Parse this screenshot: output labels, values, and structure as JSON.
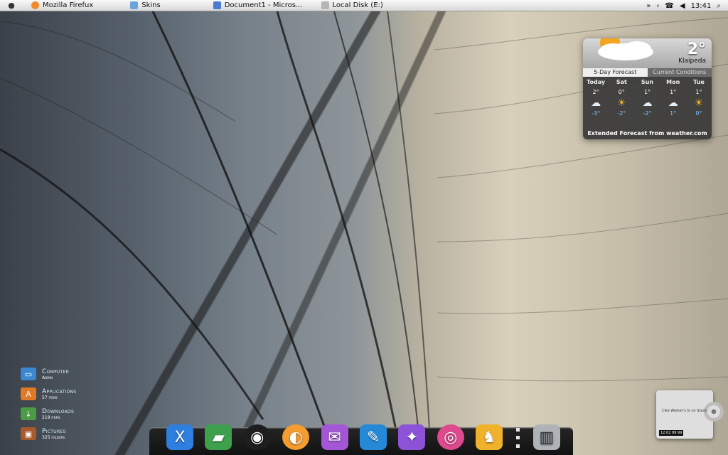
{
  "menubar": {
    "apple_icon": "apple-icon",
    "items": [
      {
        "label": "Mozilla Firefux",
        "icon": "firefox-icon",
        "color": "#f08a2a"
      },
      {
        "label": "Skins",
        "icon": "folder-icon",
        "color": "#6ca3dd"
      },
      {
        "label": "Document1 - Micros...",
        "icon": "document-icon",
        "color": "#4b7bd2"
      },
      {
        "label": "Local Disk (E:)",
        "icon": "drive-icon",
        "color": "#b5b5b5"
      }
    ],
    "right": {
      "overflow": "»",
      "tray_icons": [
        "back-icon",
        "phone-icon",
        "speaker-icon"
      ],
      "time": "13:41",
      "search_icon": "magnifier-icon"
    }
  },
  "weather": {
    "temperature": "2°",
    "city": "Klaipeda",
    "tabs": [
      "5-Day Forecast",
      "Current Conditions"
    ],
    "active_tab": 0,
    "days": [
      {
        "name": "Today",
        "high": "2°",
        "low": "-3°",
        "icon": "snow-cloud-icon"
      },
      {
        "name": "Sat",
        "high": "0°",
        "low": "-2°",
        "icon": "sun-cloud-icon"
      },
      {
        "name": "Sun",
        "high": "1°",
        "low": "-2°",
        "icon": "snow-cloud-icon"
      },
      {
        "name": "Mon",
        "high": "1°",
        "low": "1°",
        "icon": "snow-cloud-icon"
      },
      {
        "name": "Tue",
        "high": "1°",
        "low": "0°",
        "icon": "sun-cloud-icon"
      }
    ],
    "footer": "Extended Forecast from weather.com"
  },
  "places": [
    {
      "name": "Computer",
      "subtitle": "Admin",
      "icon": "monitor-icon",
      "color": "#3b88d1"
    },
    {
      "name": "Applications",
      "subtitle": "57 items",
      "icon": "apps-icon",
      "color": "#e07a26"
    },
    {
      "name": "Downloads",
      "subtitle": "219 items",
      "icon": "download-icon",
      "color": "#4c9b45"
    },
    {
      "name": "Pictures",
      "subtitle": "325 folders",
      "icon": "pictures-icon",
      "color": "#a95a2d"
    }
  ],
  "dock": {
    "items": [
      {
        "name": "finder-icon",
        "color": "#2f7fe0",
        "glyph": "X"
      },
      {
        "name": "truck-icon",
        "color": "#3ea04d",
        "glyph": "▰"
      },
      {
        "name": "music-disc-icon",
        "color": "#1e1e1e",
        "glyph": "◉"
      },
      {
        "name": "browser-icon",
        "color": "#f39c2f",
        "glyph": "◐"
      },
      {
        "name": "mail-icon",
        "color": "#a356d5",
        "glyph": "✉"
      },
      {
        "name": "feather-icon",
        "color": "#2589d8",
        "glyph": "✎"
      },
      {
        "name": "blaster-icon",
        "color": "#8c52d8",
        "glyph": "✦"
      },
      {
        "name": "donut-icon",
        "color": "#df4a8e",
        "glyph": "◎"
      },
      {
        "name": "tux-icon",
        "color": "#f0b22a",
        "glyph": "♞"
      }
    ],
    "trash_icon": {
      "name": "trash-icon",
      "color": "#aeb3b8",
      "glyph": "▥"
    }
  },
  "cd_widget": {
    "title": "Cike Worker's Iv on Stack",
    "time": "12:02 99:99"
  }
}
